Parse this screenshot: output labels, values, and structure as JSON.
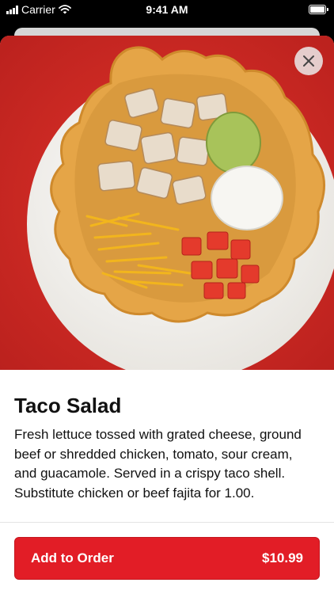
{
  "status_bar": {
    "carrier": "Carrier",
    "time": "9:41 AM"
  },
  "item": {
    "title": "Taco Salad",
    "description": "Fresh lettuce tossed with grated cheese, ground beef or shredded chicken, tomato, sour cream, and guacamole. Served in a crispy taco shell.  Substitute chicken or beef fajita for 1.00."
  },
  "order_button": {
    "label": "Add to Order",
    "price": "$10.99"
  },
  "icons": {
    "close": "close-icon",
    "signal": "signal-icon",
    "wifi": "wifi-icon",
    "battery": "battery-icon"
  },
  "colors": {
    "accent": "#e21d26",
    "hero_background": "#d42a24"
  }
}
